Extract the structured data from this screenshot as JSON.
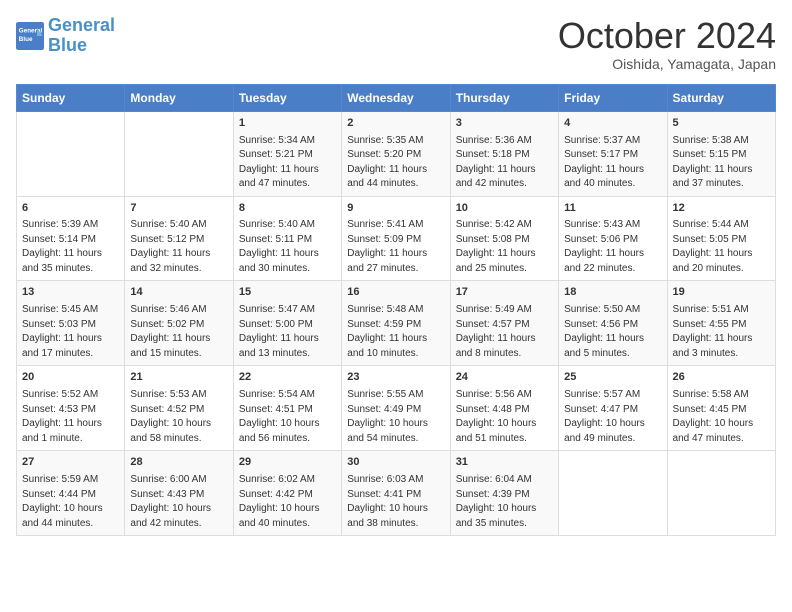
{
  "header": {
    "logo_line1": "General",
    "logo_line2": "Blue",
    "month": "October 2024",
    "location": "Oishida, Yamagata, Japan"
  },
  "days_of_week": [
    "Sunday",
    "Monday",
    "Tuesday",
    "Wednesday",
    "Thursday",
    "Friday",
    "Saturday"
  ],
  "weeks": [
    [
      {
        "num": "",
        "sunrise": "",
        "sunset": "",
        "daylight": ""
      },
      {
        "num": "",
        "sunrise": "",
        "sunset": "",
        "daylight": ""
      },
      {
        "num": "1",
        "sunrise": "Sunrise: 5:34 AM",
        "sunset": "Sunset: 5:21 PM",
        "daylight": "Daylight: 11 hours and 47 minutes."
      },
      {
        "num": "2",
        "sunrise": "Sunrise: 5:35 AM",
        "sunset": "Sunset: 5:20 PM",
        "daylight": "Daylight: 11 hours and 44 minutes."
      },
      {
        "num": "3",
        "sunrise": "Sunrise: 5:36 AM",
        "sunset": "Sunset: 5:18 PM",
        "daylight": "Daylight: 11 hours and 42 minutes."
      },
      {
        "num": "4",
        "sunrise": "Sunrise: 5:37 AM",
        "sunset": "Sunset: 5:17 PM",
        "daylight": "Daylight: 11 hours and 40 minutes."
      },
      {
        "num": "5",
        "sunrise": "Sunrise: 5:38 AM",
        "sunset": "Sunset: 5:15 PM",
        "daylight": "Daylight: 11 hours and 37 minutes."
      }
    ],
    [
      {
        "num": "6",
        "sunrise": "Sunrise: 5:39 AM",
        "sunset": "Sunset: 5:14 PM",
        "daylight": "Daylight: 11 hours and 35 minutes."
      },
      {
        "num": "7",
        "sunrise": "Sunrise: 5:40 AM",
        "sunset": "Sunset: 5:12 PM",
        "daylight": "Daylight: 11 hours and 32 minutes."
      },
      {
        "num": "8",
        "sunrise": "Sunrise: 5:40 AM",
        "sunset": "Sunset: 5:11 PM",
        "daylight": "Daylight: 11 hours and 30 minutes."
      },
      {
        "num": "9",
        "sunrise": "Sunrise: 5:41 AM",
        "sunset": "Sunset: 5:09 PM",
        "daylight": "Daylight: 11 hours and 27 minutes."
      },
      {
        "num": "10",
        "sunrise": "Sunrise: 5:42 AM",
        "sunset": "Sunset: 5:08 PM",
        "daylight": "Daylight: 11 hours and 25 minutes."
      },
      {
        "num": "11",
        "sunrise": "Sunrise: 5:43 AM",
        "sunset": "Sunset: 5:06 PM",
        "daylight": "Daylight: 11 hours and 22 minutes."
      },
      {
        "num": "12",
        "sunrise": "Sunrise: 5:44 AM",
        "sunset": "Sunset: 5:05 PM",
        "daylight": "Daylight: 11 hours and 20 minutes."
      }
    ],
    [
      {
        "num": "13",
        "sunrise": "Sunrise: 5:45 AM",
        "sunset": "Sunset: 5:03 PM",
        "daylight": "Daylight: 11 hours and 17 minutes."
      },
      {
        "num": "14",
        "sunrise": "Sunrise: 5:46 AM",
        "sunset": "Sunset: 5:02 PM",
        "daylight": "Daylight: 11 hours and 15 minutes."
      },
      {
        "num": "15",
        "sunrise": "Sunrise: 5:47 AM",
        "sunset": "Sunset: 5:00 PM",
        "daylight": "Daylight: 11 hours and 13 minutes."
      },
      {
        "num": "16",
        "sunrise": "Sunrise: 5:48 AM",
        "sunset": "Sunset: 4:59 PM",
        "daylight": "Daylight: 11 hours and 10 minutes."
      },
      {
        "num": "17",
        "sunrise": "Sunrise: 5:49 AM",
        "sunset": "Sunset: 4:57 PM",
        "daylight": "Daylight: 11 hours and 8 minutes."
      },
      {
        "num": "18",
        "sunrise": "Sunrise: 5:50 AM",
        "sunset": "Sunset: 4:56 PM",
        "daylight": "Daylight: 11 hours and 5 minutes."
      },
      {
        "num": "19",
        "sunrise": "Sunrise: 5:51 AM",
        "sunset": "Sunset: 4:55 PM",
        "daylight": "Daylight: 11 hours and 3 minutes."
      }
    ],
    [
      {
        "num": "20",
        "sunrise": "Sunrise: 5:52 AM",
        "sunset": "Sunset: 4:53 PM",
        "daylight": "Daylight: 11 hours and 1 minute."
      },
      {
        "num": "21",
        "sunrise": "Sunrise: 5:53 AM",
        "sunset": "Sunset: 4:52 PM",
        "daylight": "Daylight: 10 hours and 58 minutes."
      },
      {
        "num": "22",
        "sunrise": "Sunrise: 5:54 AM",
        "sunset": "Sunset: 4:51 PM",
        "daylight": "Daylight: 10 hours and 56 minutes."
      },
      {
        "num": "23",
        "sunrise": "Sunrise: 5:55 AM",
        "sunset": "Sunset: 4:49 PM",
        "daylight": "Daylight: 10 hours and 54 minutes."
      },
      {
        "num": "24",
        "sunrise": "Sunrise: 5:56 AM",
        "sunset": "Sunset: 4:48 PM",
        "daylight": "Daylight: 10 hours and 51 minutes."
      },
      {
        "num": "25",
        "sunrise": "Sunrise: 5:57 AM",
        "sunset": "Sunset: 4:47 PM",
        "daylight": "Daylight: 10 hours and 49 minutes."
      },
      {
        "num": "26",
        "sunrise": "Sunrise: 5:58 AM",
        "sunset": "Sunset: 4:45 PM",
        "daylight": "Daylight: 10 hours and 47 minutes."
      }
    ],
    [
      {
        "num": "27",
        "sunrise": "Sunrise: 5:59 AM",
        "sunset": "Sunset: 4:44 PM",
        "daylight": "Daylight: 10 hours and 44 minutes."
      },
      {
        "num": "28",
        "sunrise": "Sunrise: 6:00 AM",
        "sunset": "Sunset: 4:43 PM",
        "daylight": "Daylight: 10 hours and 42 minutes."
      },
      {
        "num": "29",
        "sunrise": "Sunrise: 6:02 AM",
        "sunset": "Sunset: 4:42 PM",
        "daylight": "Daylight: 10 hours and 40 minutes."
      },
      {
        "num": "30",
        "sunrise": "Sunrise: 6:03 AM",
        "sunset": "Sunset: 4:41 PM",
        "daylight": "Daylight: 10 hours and 38 minutes."
      },
      {
        "num": "31",
        "sunrise": "Sunrise: 6:04 AM",
        "sunset": "Sunset: 4:39 PM",
        "daylight": "Daylight: 10 hours and 35 minutes."
      },
      {
        "num": "",
        "sunrise": "",
        "sunset": "",
        "daylight": ""
      },
      {
        "num": "",
        "sunrise": "",
        "sunset": "",
        "daylight": ""
      }
    ]
  ]
}
